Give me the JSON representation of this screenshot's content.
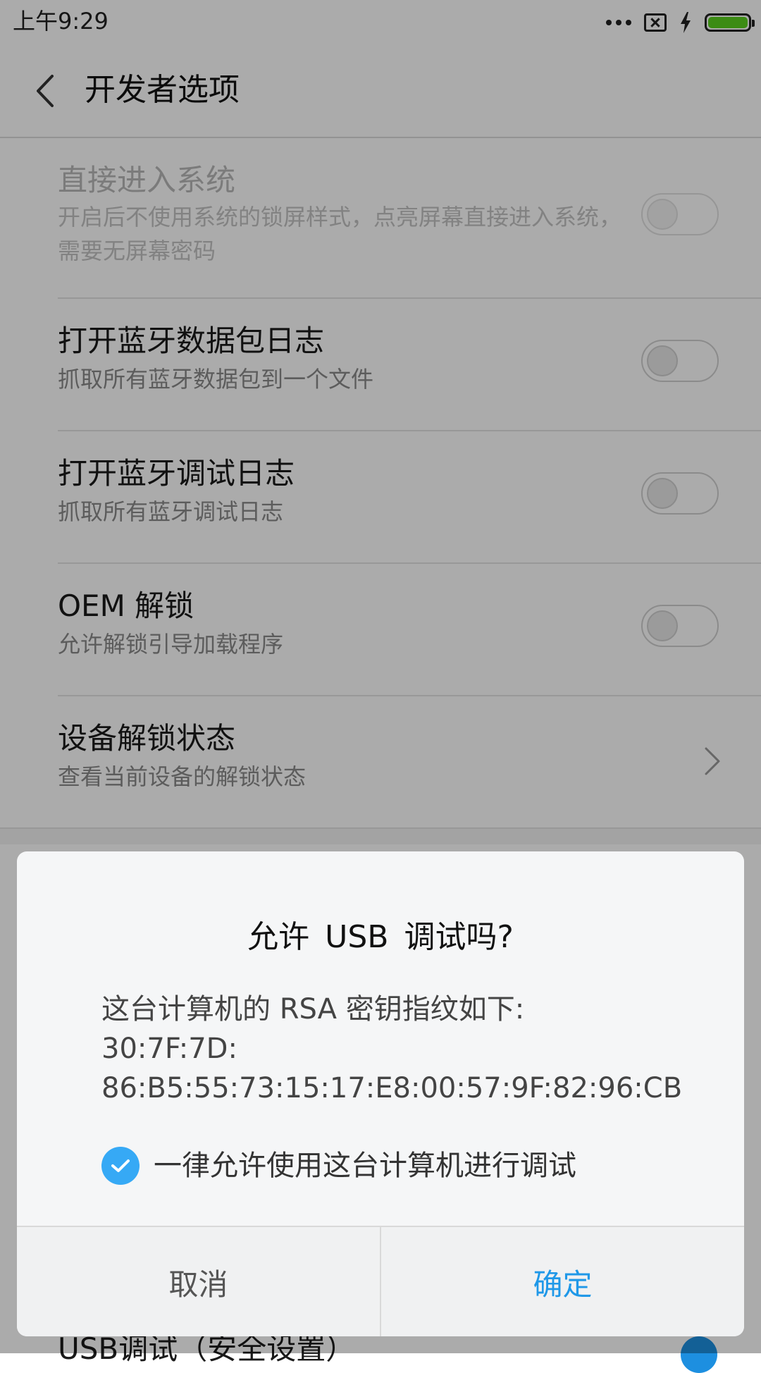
{
  "status_bar": {
    "time": "上午9:29",
    "icons": [
      "more-dots-icon",
      "sim-error-icon",
      "charging-bolt-icon",
      "battery-icon"
    ],
    "battery_color": "#5ad11e"
  },
  "header": {
    "title": "开发者选项",
    "back_icon": "chevron-left-icon"
  },
  "settings": [
    {
      "title": "直接进入系统",
      "description": "开启后不使用系统的锁屏样式，点亮屏幕直接进入系统，需要无屏幕密码",
      "control": "toggle",
      "enabled": false,
      "on": false
    },
    {
      "title": "打开蓝牙数据包日志",
      "description": "抓取所有蓝牙数据包到一个文件",
      "control": "toggle",
      "enabled": true,
      "on": false
    },
    {
      "title": "打开蓝牙调试日志",
      "description": "抓取所有蓝牙调试日志",
      "control": "toggle",
      "enabled": true,
      "on": false
    },
    {
      "title": "OEM 解锁",
      "description": "允许解锁引导加载程序",
      "control": "toggle",
      "enabled": true,
      "on": false
    },
    {
      "title": "设备解锁状态",
      "description": "查看当前设备的解锁状态",
      "control": "chevron-right-icon"
    }
  ],
  "background_partial_item": {
    "title": "USB调试（安全设置）",
    "toggle_on": true
  },
  "dialog": {
    "title": "允许 USB 调试吗?",
    "message_lines": [
      "这台计算机的 RSA 密钥指纹如下:",
      "30:7F:7D:",
      "86:B5:55:73:15:17:E8:00:57:9F:82:96:CB"
    ],
    "checkbox_label": "一律允许使用这台计算机进行调试",
    "checkbox_checked": true,
    "cancel_label": "取消",
    "confirm_label": "确定",
    "accent_color": "#1f98e8"
  }
}
